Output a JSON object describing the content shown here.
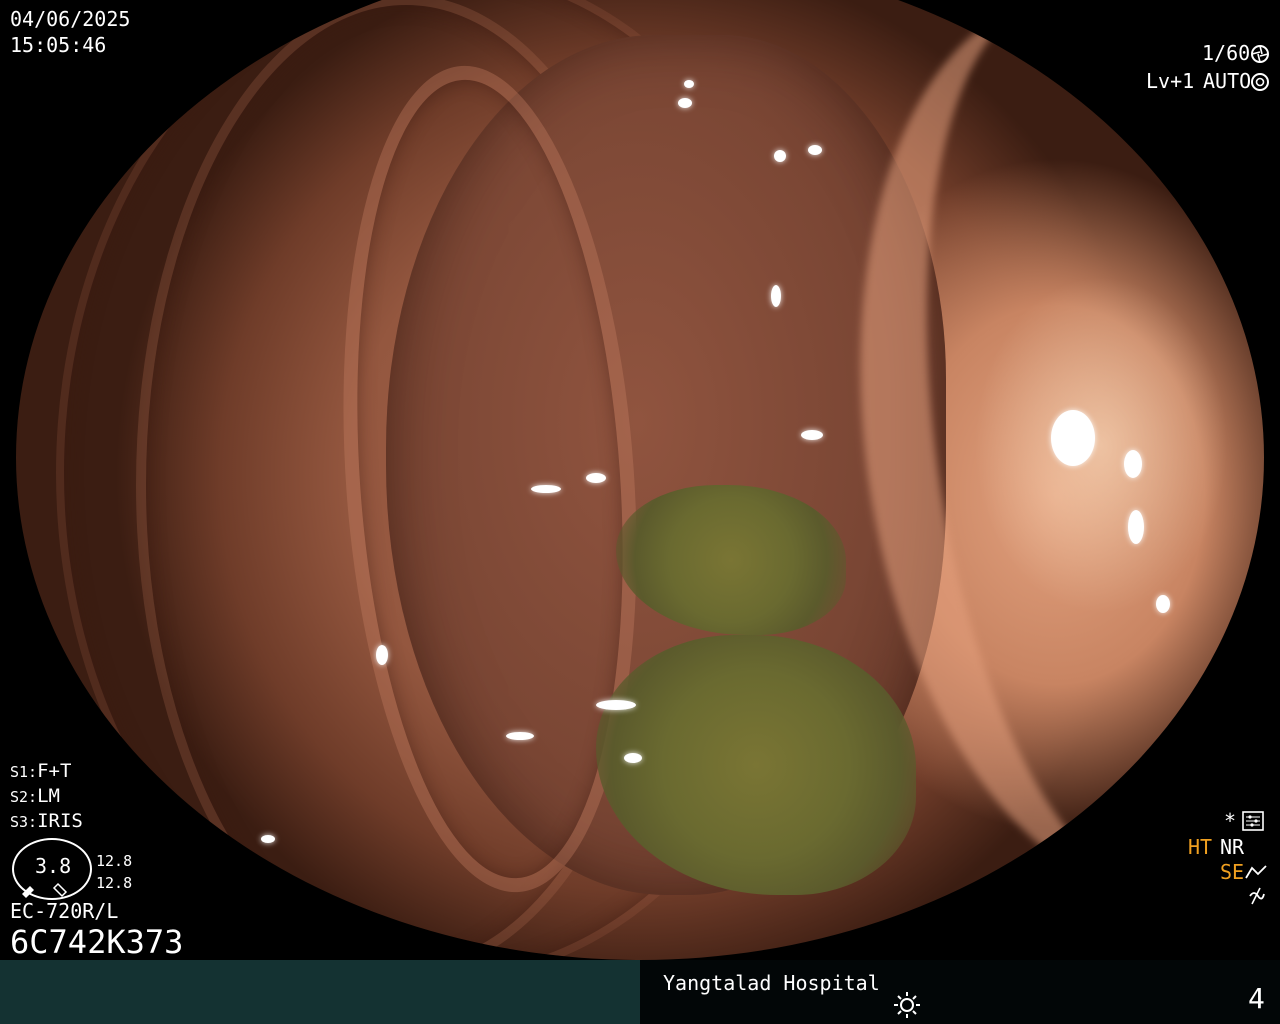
{
  "header": {
    "date": "04/06/2025",
    "time": "15:05:46",
    "shutter": "1/60",
    "level": "Lv+1",
    "exposure_mode": "AUTO"
  },
  "settings": {
    "s1_label": "S1:",
    "s1_value": "F+T",
    "s2_label": "S2:",
    "s2_value": "LM",
    "s3_label": "S3:",
    "s3_value": "IRIS"
  },
  "scope": {
    "zoom_value": "3.8",
    "reading_1": "12.8",
    "reading_2": "12.8",
    "model": "EC-720R/L",
    "serial": "6C742K373"
  },
  "right_panel": {
    "ht": "HT",
    "nr": "NR",
    "se": "SE",
    "colors": {
      "ht": "#f0a020",
      "se": "#f0a020"
    }
  },
  "footer": {
    "hospital": "Yangtalad Hospital",
    "page_number": "4"
  },
  "icons": {
    "shutter": "aperture-icon",
    "exposure": "camera-iris-icon",
    "settings": "settings-sliders-icon",
    "light": "sun-icon",
    "zoom": "zoom-indicator-icon"
  }
}
